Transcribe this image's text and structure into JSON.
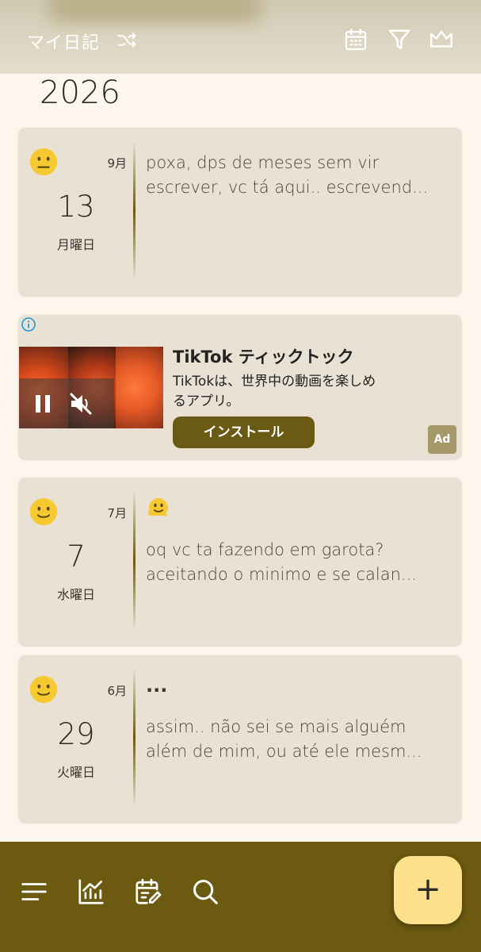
{
  "header": {
    "title": "マイ日記",
    "icons": [
      "shuffle-icon",
      "calendar-icon",
      "filter-icon",
      "crown-icon"
    ]
  },
  "year": "2026",
  "entries": [
    {
      "mood": "neutral-face",
      "month": "9月",
      "day": "13",
      "weekday": "月曜日",
      "title": "",
      "preview": [
        "poxa, dps de meses sem vir",
        "escrever, vc tá aqui.. escrevend..."
      ]
    },
    {
      "mood": "smiling-face",
      "month": "7月",
      "day": "7",
      "weekday": "水曜日",
      "title": "melting-face-emoji",
      "preview": [
        "oq vc ta fazendo em garota?",
        "aceitando o minimo e se calan..."
      ]
    },
    {
      "mood": "smiling-face",
      "month": "6月",
      "day": "29",
      "weekday": "火曜日",
      "title": "...",
      "preview": [
        "assim.. não sei se mais alguém",
        "além de mim, ou até ele mesm..."
      ]
    }
  ],
  "ad": {
    "title": "TikTok ティックトック",
    "description": "TikTokは、世界中の動画を楽しめるアプリ。",
    "install_label": "インストール",
    "badge": "Ad"
  },
  "bottom_nav": {
    "items": [
      "menu-icon",
      "stats-icon",
      "edit-calendar-icon",
      "search-icon"
    ],
    "fab_label": "+"
  },
  "colors": {
    "accent": "#6b5a10",
    "card": "#e9e1d4",
    "background": "#fdf6ec",
    "fab": "#fde08c"
  }
}
